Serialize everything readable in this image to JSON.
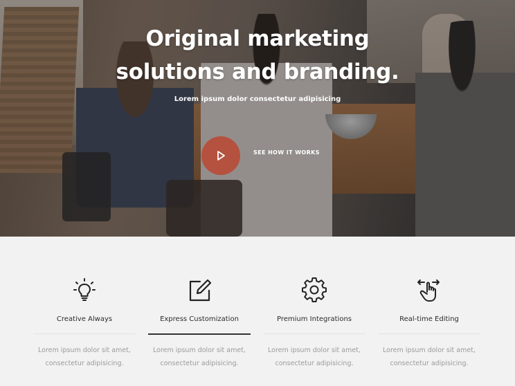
{
  "hero": {
    "title_line1": "Original marketing",
    "title_line2": "solutions and branding.",
    "subtitle": "Lorem ipsum dolor consectetur adipisicing",
    "cta_label": "SEE HOW IT WORKS",
    "accent_color": "#b4523f",
    "play_icon": "play-icon"
  },
  "features": [
    {
      "icon": "lightbulb-icon",
      "title": "Creative Always",
      "desc_line1": "Lorem ipsum dolor sit amet,",
      "desc_line2": "consectetur adipisicing.",
      "active": false
    },
    {
      "icon": "edit-icon",
      "title": "Express Customization",
      "desc_line1": "Lorem ipsum dolor sit amet,",
      "desc_line2": "consectetur adipisicing.",
      "active": true
    },
    {
      "icon": "gear-icon",
      "title": "Premium Integrations",
      "desc_line1": "Lorem ipsum dolor sit amet,",
      "desc_line2": "consectetur adipisicing.",
      "active": false
    },
    {
      "icon": "touch-swipe-icon",
      "title": "Real-time Editing",
      "desc_line1": "Lorem ipsum dolor sit amet,",
      "desc_line2": "consectetur adipisicing.",
      "active": false
    }
  ]
}
